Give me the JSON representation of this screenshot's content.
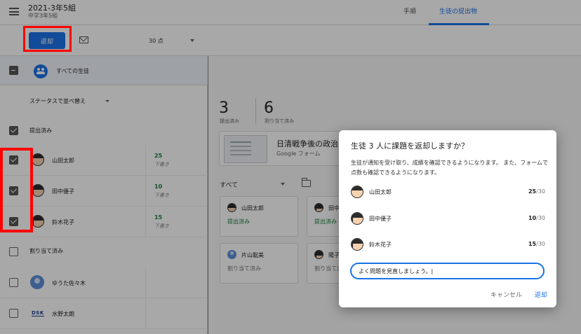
{
  "header": {
    "class_title": "2021-3年5組",
    "class_subtitle": "中学3年5組",
    "tabs": [
      {
        "label": "手順"
      },
      {
        "label": "生徒の提出物"
      }
    ]
  },
  "toolbar": {
    "return_label": "返却",
    "points_value": "30 点"
  },
  "student_list": {
    "all_students_label": "すべての生徒",
    "sort_label": "ステータスで並べ替え",
    "submitted_group_label": "提出済み",
    "assigned_group_label": "割り当て済み",
    "students": [
      {
        "name": "山田太郎",
        "grade": "25",
        "grade_note": "下書き"
      },
      {
        "name": "田中優子",
        "grade": "10",
        "grade_note": "下書き"
      },
      {
        "name": "鈴木花子",
        "grade": "15",
        "grade_note": "下書き"
      },
      {
        "name": "ゆうた佐々木"
      },
      {
        "name": "水野太朗",
        "logo": "DSK"
      }
    ]
  },
  "summary": {
    "submitted_count": "3",
    "submitted_label": "提出済み",
    "assigned_count": "6",
    "assigned_label": "割り当て済み"
  },
  "assignment": {
    "title": "日清戦争後の政治",
    "type": "Google フォーム"
  },
  "filter": {
    "label": "すべて"
  },
  "cards": [
    {
      "name": "山田太郎",
      "status": "提出済み"
    },
    {
      "name": "田中",
      "status": "提出済み"
    },
    {
      "name": "片山聡美",
      "status": "割り当て済み"
    },
    {
      "name": "陽子",
      "status": "割り当て済み"
    }
  ],
  "dialog": {
    "title": "生徒 3 人に課題を返却しますか？",
    "description": "生徒が通知を受け取り、成績を確認できるようになります。 また、フォームで点数も確認できるようになります。",
    "students": [
      {
        "name": "山田太郎",
        "score": "25",
        "max": "/30"
      },
      {
        "name": "田中優子",
        "score": "10",
        "max": "/30"
      },
      {
        "name": "鈴木花子",
        "score": "15",
        "max": "/30"
      }
    ],
    "comment": "よく問題を見直しましょう。|",
    "cancel_label": "キャンセル",
    "return_label": "返却"
  },
  "colors": {
    "accent": "#1a73e8",
    "grade_green": "#188038",
    "annotation_red": "#ff0000"
  }
}
